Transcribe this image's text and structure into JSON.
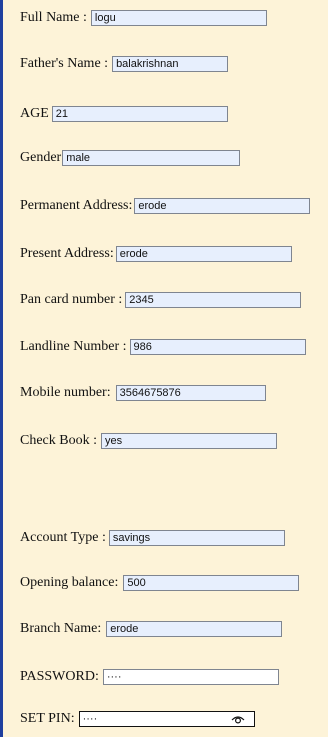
{
  "form": {
    "full_name": {
      "label": "Full Name :",
      "value": "logu"
    },
    "father_name": {
      "label": "Father's Name :",
      "value": "balakrishnan"
    },
    "age": {
      "label": "AGE",
      "value": "21"
    },
    "gender": {
      "label": "Gender",
      "value": "male"
    },
    "permanent_address": {
      "label": "Permanent Address:",
      "value": "erode"
    },
    "present_address": {
      "label": "Present Address:",
      "value": "erode"
    },
    "pan_card": {
      "label": "Pan card number :",
      "value": "2345"
    },
    "landline": {
      "label": "Landline Number :",
      "value": "986"
    },
    "mobile": {
      "label": "Mobile number:",
      "value": "3564675876"
    },
    "check_book": {
      "label": "Check Book :",
      "value": "yes"
    },
    "account_type": {
      "label": "Account Type :",
      "value": "savings"
    },
    "opening_balance": {
      "label": "Opening balance:",
      "value": "500"
    },
    "branch_name": {
      "label": "Branch Name:",
      "value": "erode"
    },
    "password": {
      "label": "PASSWORD:",
      "value": "····"
    },
    "set_pin": {
      "label": "SET PIN:",
      "value": "····",
      "icon": "eye-icon"
    }
  },
  "colors": {
    "background": "#fdf3d8",
    "field_fill": "#e7effd",
    "left_bar": "#1f3f9e"
  }
}
